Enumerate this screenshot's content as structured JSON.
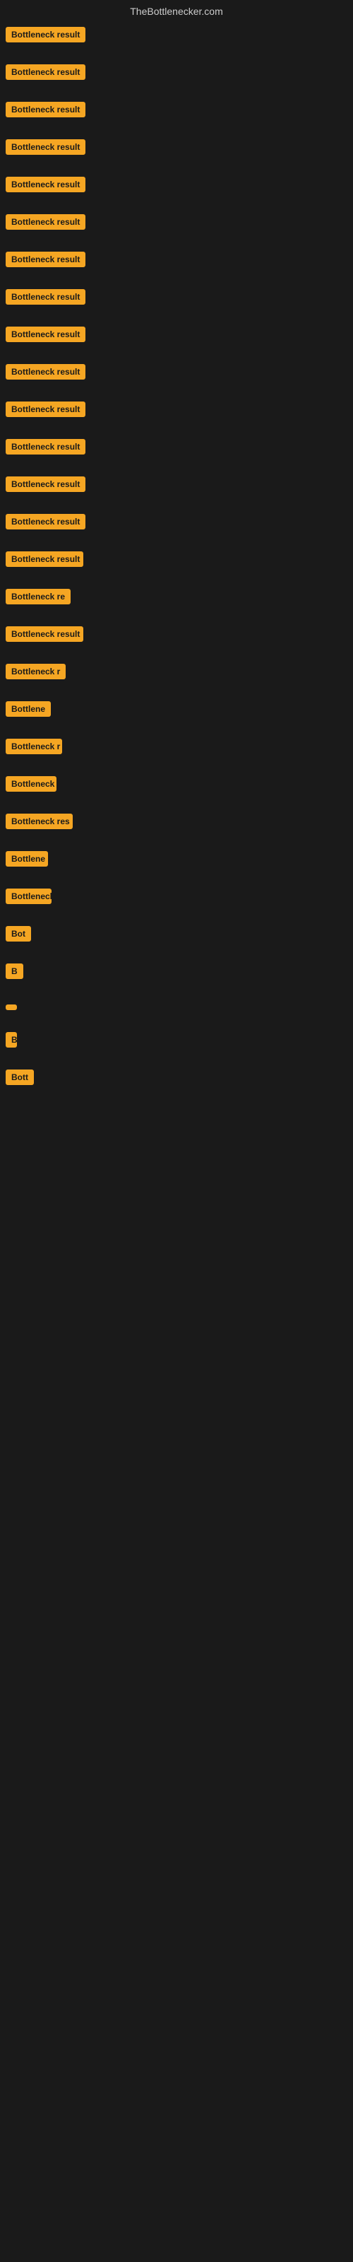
{
  "header": {
    "title": "TheBottlenecker.com"
  },
  "items": [
    {
      "id": 0,
      "label": "Bottleneck result"
    },
    {
      "id": 1,
      "label": "Bottleneck result"
    },
    {
      "id": 2,
      "label": "Bottleneck result"
    },
    {
      "id": 3,
      "label": "Bottleneck result"
    },
    {
      "id": 4,
      "label": "Bottleneck result"
    },
    {
      "id": 5,
      "label": "Bottleneck result"
    },
    {
      "id": 6,
      "label": "Bottleneck result"
    },
    {
      "id": 7,
      "label": "Bottleneck result"
    },
    {
      "id": 8,
      "label": "Bottleneck result"
    },
    {
      "id": 9,
      "label": "Bottleneck result"
    },
    {
      "id": 10,
      "label": "Bottleneck result"
    },
    {
      "id": 11,
      "label": "Bottleneck result"
    },
    {
      "id": 12,
      "label": "Bottleneck result"
    },
    {
      "id": 13,
      "label": "Bottleneck result"
    },
    {
      "id": 14,
      "label": "Bottleneck result"
    },
    {
      "id": 15,
      "label": "Bottleneck re"
    },
    {
      "id": 16,
      "label": "Bottleneck result"
    },
    {
      "id": 17,
      "label": "Bottleneck r"
    },
    {
      "id": 18,
      "label": "Bottlene"
    },
    {
      "id": 19,
      "label": "Bottleneck r"
    },
    {
      "id": 20,
      "label": "Bottleneck"
    },
    {
      "id": 21,
      "label": "Bottleneck res"
    },
    {
      "id": 22,
      "label": "Bottlene"
    },
    {
      "id": 23,
      "label": "Bottleneck"
    },
    {
      "id": 24,
      "label": "Bot"
    },
    {
      "id": 25,
      "label": "B"
    },
    {
      "id": 26,
      "label": ""
    },
    {
      "id": 27,
      "label": "B"
    },
    {
      "id": 28,
      "label": "Bott"
    },
    {
      "id": 29,
      "label": ""
    },
    {
      "id": 30,
      "label": ""
    },
    {
      "id": 31,
      "label": ""
    },
    {
      "id": 32,
      "label": ""
    },
    {
      "id": 33,
      "label": ""
    }
  ]
}
